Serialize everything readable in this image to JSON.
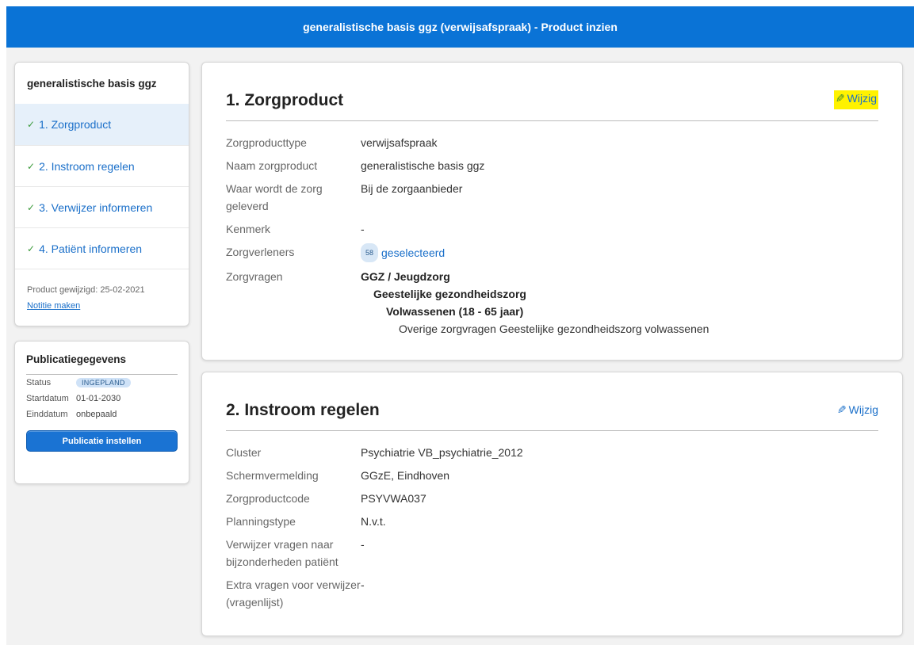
{
  "header": {
    "title": "generalistische basis ggz (verwijsafspraak) - Product inzien"
  },
  "sidebar": {
    "title": "generalistische basis ggz",
    "items": [
      {
        "label": "1. Zorgproduct"
      },
      {
        "label": "2. Instroom regelen"
      },
      {
        "label": "3. Verwijzer informeren"
      },
      {
        "label": "4. Patiënt informeren"
      }
    ],
    "modified": "Product gewijzigd: 25-02-2021",
    "note_link": "Notitie maken"
  },
  "publication": {
    "title": "Publicatiegegevens",
    "status_label": "Status",
    "status_value": "INGEPLAND",
    "start_label": "Startdatum",
    "start_value": "01-01-2030",
    "end_label": "Einddatum",
    "end_value": "onbepaald",
    "button": "Publicatie instellen"
  },
  "section1": {
    "title": "1. Zorgproduct",
    "edit": "Wijzig",
    "rows": [
      {
        "k": "Zorgproducttype",
        "v": "verwijsafspraak"
      },
      {
        "k": "Naam zorgproduct",
        "v": "generalistische basis ggz"
      },
      {
        "k": "Waar wordt de zorg geleverd",
        "v": "Bij de zorgaanbieder"
      },
      {
        "k": "Kenmerk",
        "v": "-"
      },
      {
        "k": "Zorgverleners",
        "v": "geselecteerd",
        "count": "58"
      },
      {
        "k": "Zorgvragen",
        "v": ""
      }
    ],
    "tree": [
      "GGZ / Jeugdzorg",
      "Geestelijke gezondheidszorg",
      "Volwassenen (18 - 65 jaar)",
      "Overige zorgvragen Geestelijke gezondheidszorg volwassenen"
    ]
  },
  "section2": {
    "title": "2. Instroom regelen",
    "edit": "Wijzig",
    "rows": [
      {
        "k": "Cluster",
        "v": "Psychiatrie VB_psychiatrie_2012"
      },
      {
        "k": "Schermvermelding",
        "v": "GGzE, Eindhoven"
      },
      {
        "k": "Zorgproductcode",
        "v": "PSYVWA037"
      },
      {
        "k": "Planningstype",
        "v": "N.v.t."
      },
      {
        "k": "Verwijzer vragen naar bijzonderheden patiënt",
        "v": "-"
      },
      {
        "k": "Extra vragen voor verwijzer (vragenlijst)",
        "v": "-"
      }
    ]
  },
  "colors": {
    "accent": "#0a73d6",
    "highlight": "#fff200",
    "link": "#1a6fc9"
  }
}
